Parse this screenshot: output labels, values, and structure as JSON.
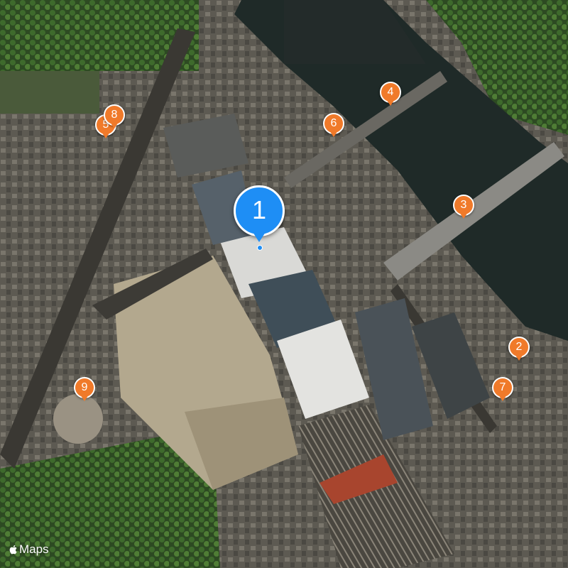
{
  "map": {
    "selected_marker": {
      "label": "1",
      "color": "#1e8ef5"
    },
    "markers": [
      {
        "id": "marker-2",
        "label": "2",
        "color": "#f07a2a"
      },
      {
        "id": "marker-3",
        "label": "3",
        "color": "#f07a2a"
      },
      {
        "id": "marker-4",
        "label": "4",
        "color": "#f07a2a"
      },
      {
        "id": "marker-5",
        "label": "5",
        "color": "#f07a2a"
      },
      {
        "id": "marker-6",
        "label": "6",
        "color": "#f07a2a"
      },
      {
        "id": "marker-7",
        "label": "7",
        "color": "#f07a2a"
      },
      {
        "id": "marker-8",
        "label": "8",
        "color": "#f07a2a"
      },
      {
        "id": "marker-9",
        "label": "9",
        "color": "#f07a2a"
      }
    ],
    "attribution": {
      "logo_icon": "apple-logo-icon",
      "text": "Maps"
    }
  }
}
